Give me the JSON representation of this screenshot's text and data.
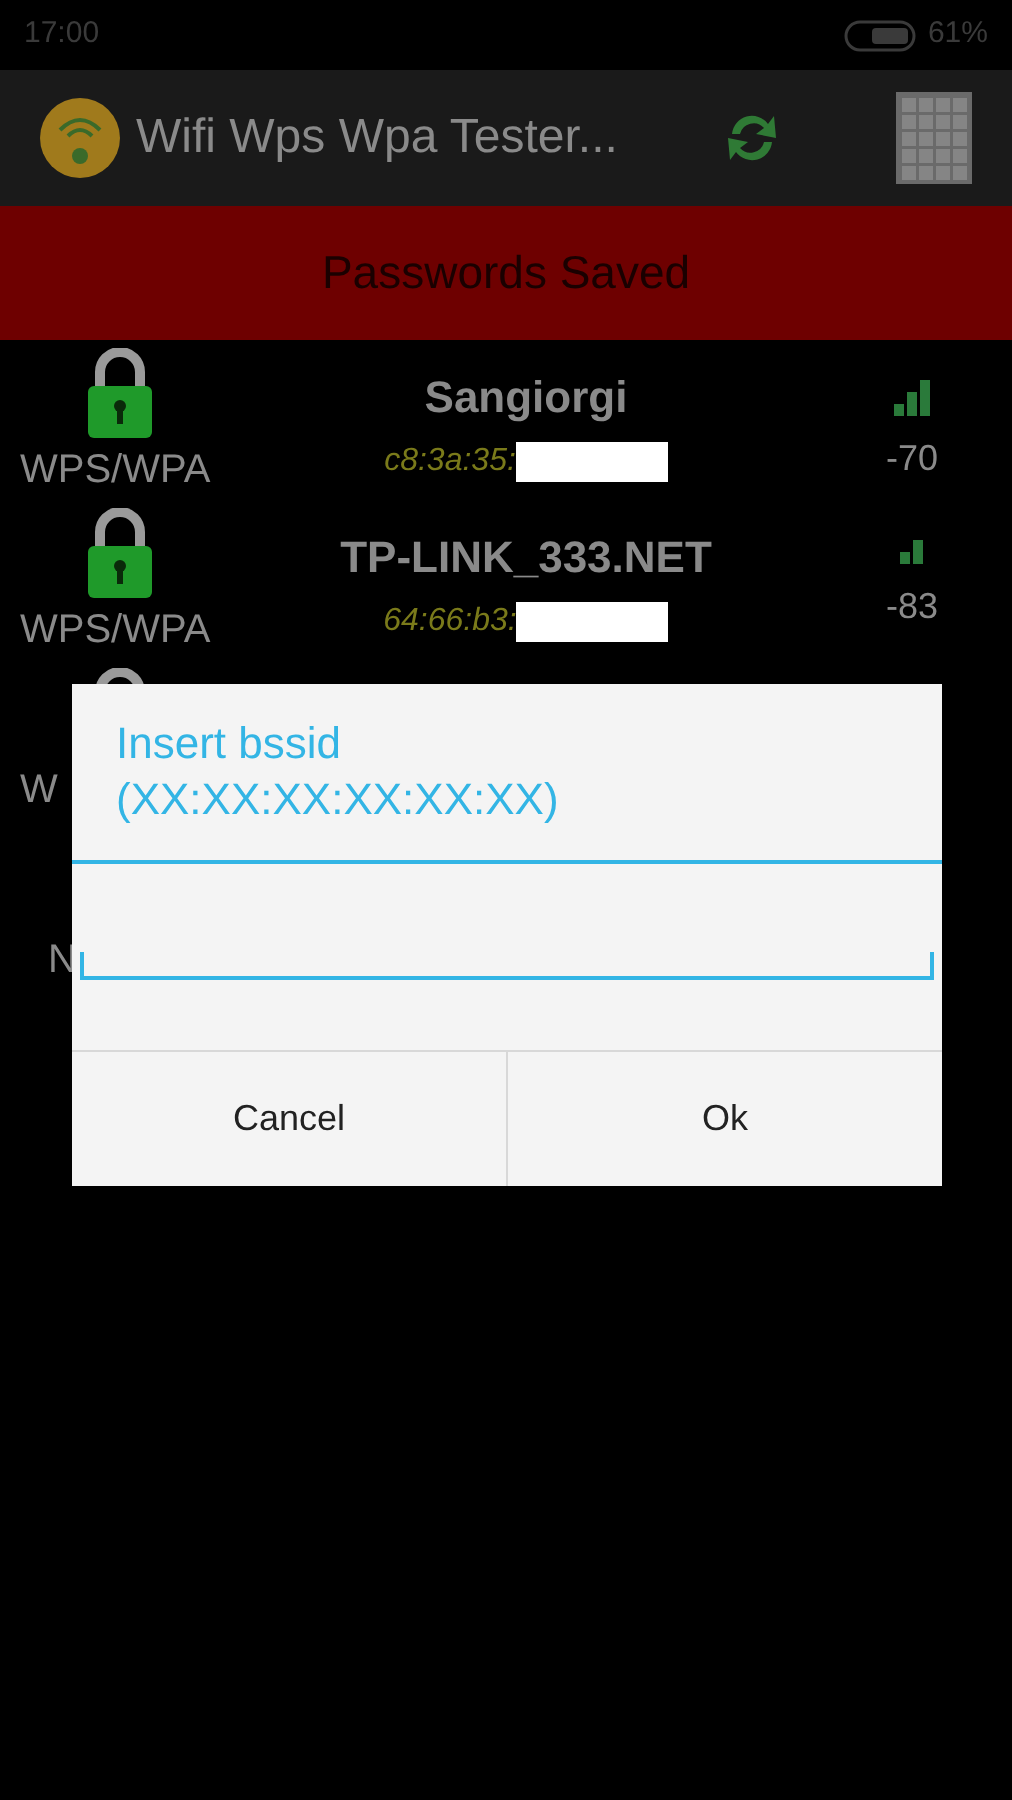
{
  "status_bar": {
    "time": "17:00",
    "battery": "61%"
  },
  "app_bar": {
    "title": "Wifi Wps Wpa Tester..."
  },
  "banner": "Passwords Saved",
  "networks": [
    {
      "security": "WPS/WPA",
      "name": "Sangiorgi",
      "bssid": "c8:3a:35:",
      "signal": "-70"
    },
    {
      "security": "WPS/WPA",
      "name": "TP-LINK_333.NET",
      "bssid": "64:66:b3:",
      "signal": "-83"
    },
    {
      "security": "W"
    }
  ],
  "partial_text": "N",
  "dialog": {
    "title": "Insert bssid\n(XX:XX:XX:XX:XX:XX)",
    "buttons": [
      "Cancel",
      "Ok"
    ]
  }
}
